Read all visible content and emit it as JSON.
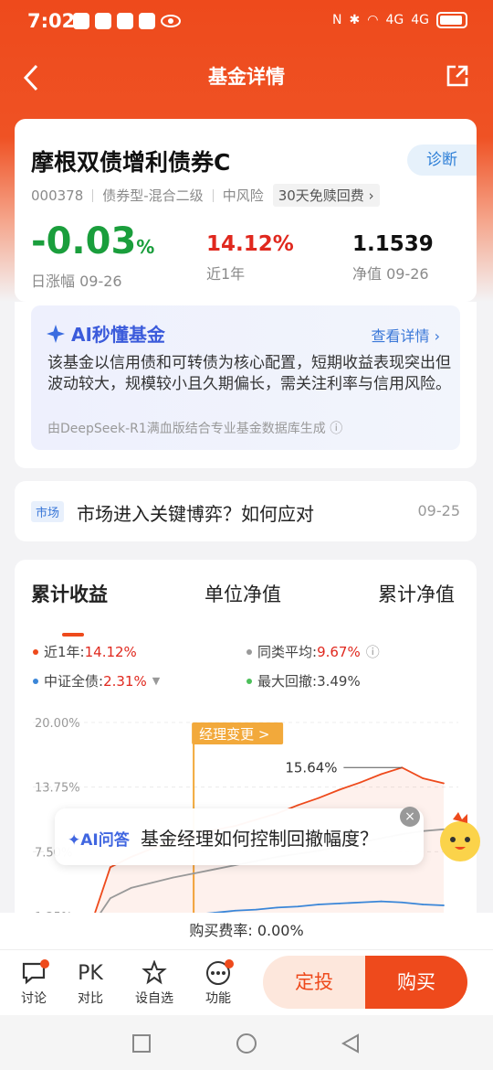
{
  "status_bar": {
    "time": "7:02",
    "signal1": "4G",
    "signal2": "4G"
  },
  "header": {
    "title": "基金详情"
  },
  "fund": {
    "name": "摩根双债增利债券C",
    "diagnose": "诊断",
    "code": "000378",
    "type": "债券型-混合二级",
    "risk": "中风险",
    "fee_tag": "30天免赎回费",
    "daily_change": "-0.03",
    "daily_change_unit": "%",
    "daily_label": "日涨幅 09-26",
    "year_return": "14.12%",
    "year_label": "近1年",
    "nav": "1.1539",
    "nav_label": "净值 09-26"
  },
  "ai_summary": {
    "title": "AI秒懂基金",
    "link": "查看详情",
    "body": "该基金以信用债和可转债为核心配置，短期收益表现突出但波动较大，规模较小且久期偏长，需关注利率与信用风险。",
    "footer": "由DeepSeek-R1满血版结合专业基金数据库生成"
  },
  "news": {
    "tag": "市场",
    "text": "市场进入关键博弈？如何应对",
    "date": "09-25"
  },
  "chart_tabs": [
    "累计收益",
    "单位净值",
    "累计净值"
  ],
  "legend": {
    "fund_label": "近1年:",
    "fund_value": "14.12%",
    "avg_label": "同类平均:",
    "avg_value": "9.67%",
    "index_label": "中证全债:",
    "index_value": "2.31%",
    "drawdown_label": "最大回撤:",
    "drawdown_value": "3.49%"
  },
  "colors": {
    "fund": "#ee4a1c",
    "avg": "#999999",
    "index": "#3a86d8",
    "drawdown": "#4cbf5a",
    "accent": "#ee4a1c"
  },
  "chart_data": {
    "type": "line",
    "yticks": [
      "20.00%",
      "13.75%",
      "7.50%",
      "1.25%"
    ],
    "ylim": [
      1.25,
      20.0
    ],
    "marker_label": "经理变更 >",
    "peak_label": "15.64%",
    "series": [
      {
        "name": "近1年",
        "values": [
          0,
          6,
          7,
          7.8,
          8.5,
          9,
          9.6,
          10,
          10.6,
          11.2,
          12,
          12.7,
          13.5,
          14.2,
          15,
          15.64,
          14.6,
          14.12
        ]
      },
      {
        "name": "同类平均",
        "values": [
          0,
          3,
          4,
          4.5,
          5,
          5.4,
          5.8,
          6.2,
          6.6,
          7,
          7.3,
          7.6,
          8,
          8.4,
          8.8,
          9.2,
          9.5,
          9.67
        ]
      },
      {
        "name": "中证全债",
        "values": [
          0,
          0.5,
          0.8,
          1,
          1.2,
          1.4,
          1.6,
          1.8,
          1.9,
          2.1,
          2.2,
          2.4,
          2.5,
          2.6,
          2.7,
          2.6,
          2.4,
          2.31
        ]
      }
    ]
  },
  "ai_popup": {
    "tag": "AI问答",
    "question": "基金经理如何控制回撤幅度？"
  },
  "fee_line": "购买费率: 0.00%",
  "bottom_bar": {
    "discuss": "讨论",
    "compare_icon": "PK",
    "compare": "对比",
    "watchlist": "设自选",
    "functions": "功能",
    "dingtou": "定投",
    "buy": "购买"
  }
}
